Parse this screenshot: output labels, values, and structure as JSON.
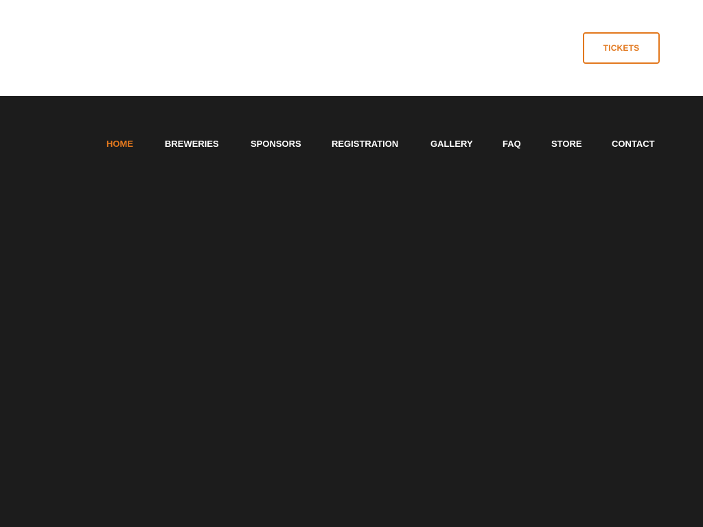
{
  "header": {
    "tickets_label": "TICKETS"
  },
  "nav": {
    "items": [
      {
        "label": "HOME",
        "active": true
      },
      {
        "label": "BREWERIES",
        "active": false
      },
      {
        "label": "SPONSORS",
        "active": false
      },
      {
        "label": "REGISTRATION",
        "active": false
      },
      {
        "label": "GALLERY",
        "active": false
      },
      {
        "label": "FAQ",
        "active": false
      },
      {
        "label": "STORE",
        "active": false
      },
      {
        "label": "CONTACT",
        "active": false
      }
    ]
  },
  "colors": {
    "accent": "#e2781e",
    "header_background": "#ffffff",
    "main_background": "#1c1c1c",
    "nav_text": "#ffffff"
  }
}
